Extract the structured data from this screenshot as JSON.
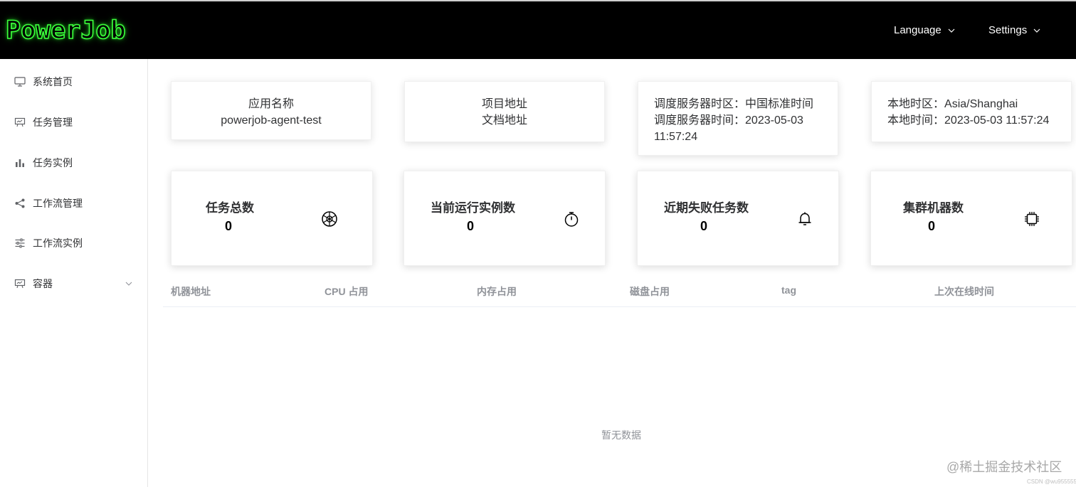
{
  "header": {
    "logo": "PowerJob",
    "language_label": "Language",
    "settings_label": "Settings"
  },
  "sidebar": {
    "items": [
      {
        "label": "系统首页",
        "icon": "monitor-icon"
      },
      {
        "label": "任务管理",
        "icon": "presentation-icon"
      },
      {
        "label": "任务实例",
        "icon": "bar-chart-icon"
      },
      {
        "label": "工作流管理",
        "icon": "share-icon"
      },
      {
        "label": "工作流实例",
        "icon": "sliders-icon"
      },
      {
        "label": "容器",
        "icon": "presentation-icon",
        "expandable": true
      }
    ]
  },
  "info": {
    "app": {
      "title": "应用名称",
      "value": "powerjob-agent-test"
    },
    "links": {
      "project": "项目地址",
      "docs": "文档地址"
    },
    "server": {
      "timezone_label": "调度服务器时区：",
      "timezone_value": "中国标准时间",
      "time_label": "调度服务器时间：",
      "time_value": "2023-05-03 11:57:24"
    },
    "local": {
      "timezone_label": "本地时区：",
      "timezone_value": "Asia/Shanghai",
      "time_label": "本地时间：",
      "time_value": "2023-05-03 11:57:24"
    }
  },
  "stats": [
    {
      "title": "任务总数",
      "value": "0",
      "icon": "aperture-icon"
    },
    {
      "title": "当前运行实例数",
      "value": "0",
      "icon": "stopwatch-icon"
    },
    {
      "title": "近期失败任务数",
      "value": "0",
      "icon": "bell-icon"
    },
    {
      "title": "集群机器数",
      "value": "0",
      "icon": "cpu-icon"
    }
  ],
  "table": {
    "columns": [
      "机器地址",
      "CPU 占用",
      "内存占用",
      "磁盘占用",
      "tag",
      "上次在线时间"
    ],
    "empty_text": "暂无数据"
  },
  "watermark": {
    "main": "@稀土掘金技术社区",
    "small": "CSDN @wu955555"
  }
}
